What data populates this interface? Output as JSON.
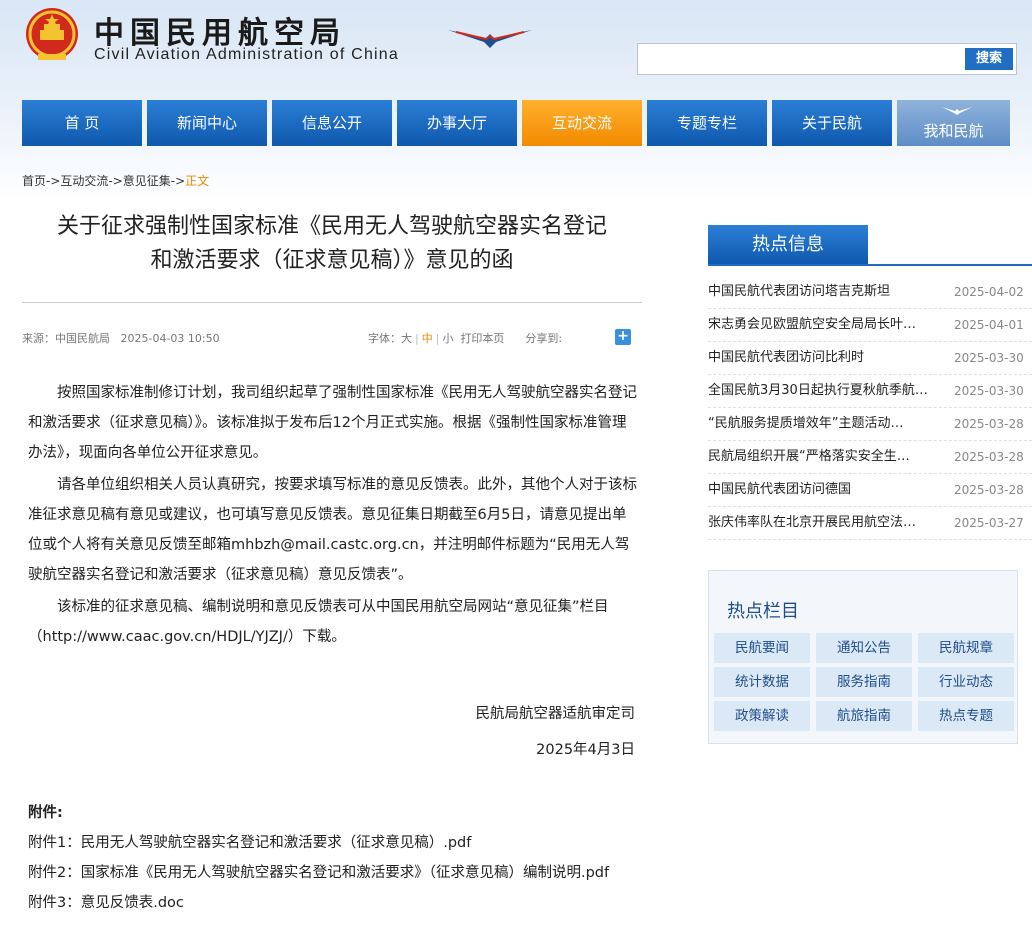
{
  "header": {
    "site_title": "中国民用航空局",
    "site_subtitle": "Civil Aviation Administration of China",
    "search": {
      "placeholder": "",
      "button_label": "搜索"
    }
  },
  "nav": {
    "items": [
      {
        "label": "首 页"
      },
      {
        "label": "新闻中心"
      },
      {
        "label": "信息公开"
      },
      {
        "label": "办事大厅"
      },
      {
        "label": "互动交流"
      },
      {
        "label": "专题专栏"
      },
      {
        "label": "关于民航"
      },
      {
        "label": "我和民航"
      }
    ],
    "active_index": 4
  },
  "breadcrumb": {
    "path": "首页->互动交流->意见征集->",
    "current": "正文"
  },
  "article": {
    "title_line1": "关于征求强制性国家标准《民用无人驾驶航空器实名登记",
    "title_line2": "和激活要求（征求意见稿）》意见的函",
    "source": "来源：中国民航局",
    "date_time": "2025-04-03 10:50",
    "font_label": "字体：",
    "font_large": "大",
    "font_medium": "中",
    "font_small": "小",
    "print_label": "打印本页",
    "share_label": "分享到:",
    "paragraphs": [
      "按照国家标准制修订计划，我司组织起草了强制性国家标准《民用无人驾驶航空器实名登记和激活要求（征求意见稿）》。该标准拟于发布后12个月正式实施。根据《强制性国家标准管理办法》，现面向各单位公开征求意见。",
      "请各单位组织相关人员认真研究，按要求填写标准的意见反馈表。此外，其他个人对于该标准征求意见稿有意见或建议，也可填写意见反馈表。意见征集日期截至6月5日，请意见提出单位或个人将有关意见反馈至邮箱mhbzh@mail.castc.org.cn，并注明邮件标题为“民用无人驾驶航空器实名登记和激活要求（征求意见稿）意见反馈表”。",
      "该标准的征求意见稿、编制说明和意见反馈表可从中国民用航空局网站“意见征集”栏目（http://www.caac.gov.cn/HDJL/YJZJ/）下载。"
    ],
    "signature": "民航局航空器适航审定司",
    "sign_date": "2025年4月3日",
    "attachments_label": "附件:",
    "attachments": [
      "附件1：民用无人驾驶航空器实名登记和激活要求（征求意见稿）.pdf",
      "附件2：国家标准《民用无人驾驶航空器实名登记和激活要求》（征求意见稿）编制说明.pdf",
      "附件3：意见反馈表.doc"
    ]
  },
  "hot_info": {
    "title": "热点信息",
    "items": [
      {
        "title": "中国民航代表团访问塔吉克斯坦",
        "date": "2025-04-02"
      },
      {
        "title": "宋志勇会见欧盟航空安全局局长叶…",
        "date": "2025-04-01"
      },
      {
        "title": "中国民航代表团访问比利时",
        "date": "2025-03-30"
      },
      {
        "title": "全国民航3月30日起执行夏秋航季航…",
        "date": "2025-03-30"
      },
      {
        "title": "“民航服务提质增效年”主题活动…",
        "date": "2025-03-28"
      },
      {
        "title": "民航局组织开展“严格落实安全生…",
        "date": "2025-03-28"
      },
      {
        "title": "中国民航代表团访问德国",
        "date": "2025-03-28"
      },
      {
        "title": "张庆伟率队在北京开展民用航空法…",
        "date": "2025-03-27"
      }
    ]
  },
  "hot_columns": {
    "title": "热点栏目",
    "items": [
      "民航要闻",
      "通知公告",
      "民航规章",
      "统计数据",
      "服务指南",
      "行业动态",
      "政策解读",
      "航旅指南",
      "热点专题"
    ]
  },
  "colors": {
    "nav_blue": "#0e58ad",
    "nav_active": "#f28a00",
    "accent_link": "#1f4e8c"
  }
}
